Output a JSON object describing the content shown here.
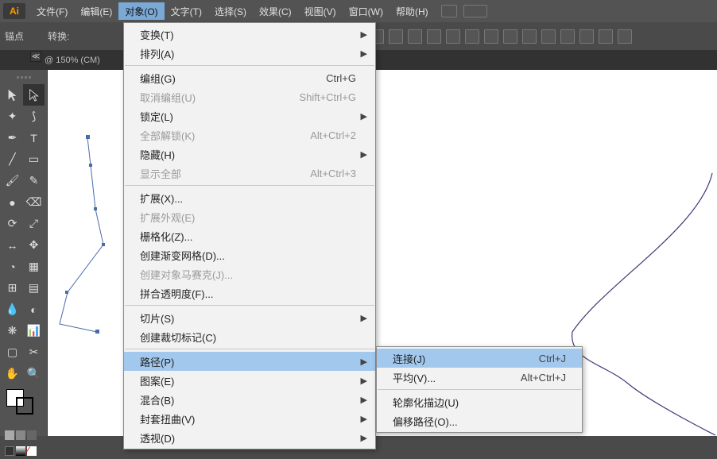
{
  "app": {
    "logo": "Ai"
  },
  "menubar": {
    "file": "文件(F)",
    "edit": "编辑(E)",
    "object": "对象(O)",
    "type": "文字(T)",
    "select": "选择(S)",
    "effect": "效果(C)",
    "view": "视图(V)",
    "window": "窗口(W)",
    "help": "帮助(H)"
  },
  "optionsbar": {
    "anchor": "锚点",
    "convert": "转换:"
  },
  "doctab": {
    "label": "@ 150% (CM)",
    "close": "≪"
  },
  "dropdown": [
    {
      "label": "变换(T)",
      "arrow": true
    },
    {
      "label": "排列(A)",
      "arrow": true
    },
    {
      "sep": true
    },
    {
      "label": "编组(G)",
      "shortcut": "Ctrl+G"
    },
    {
      "label": "取消编组(U)",
      "shortcut": "Shift+Ctrl+G",
      "disabled": true
    },
    {
      "label": "锁定(L)",
      "arrow": true
    },
    {
      "label": "全部解锁(K)",
      "shortcut": "Alt+Ctrl+2",
      "disabled": true
    },
    {
      "label": "隐藏(H)",
      "arrow": true
    },
    {
      "label": "显示全部",
      "shortcut": "Alt+Ctrl+3",
      "disabled": true
    },
    {
      "sep": true
    },
    {
      "label": "扩展(X)..."
    },
    {
      "label": "扩展外观(E)",
      "disabled": true
    },
    {
      "label": "栅格化(Z)..."
    },
    {
      "label": "创建渐变网格(D)..."
    },
    {
      "label": "创建对象马赛克(J)...",
      "disabled": true
    },
    {
      "label": "拼合透明度(F)..."
    },
    {
      "sep": true
    },
    {
      "label": "切片(S)",
      "arrow": true
    },
    {
      "label": "创建裁切标记(C)"
    },
    {
      "sep": true
    },
    {
      "label": "路径(P)",
      "arrow": true,
      "hover": true
    },
    {
      "label": "图案(E)",
      "arrow": true
    },
    {
      "label": "混合(B)",
      "arrow": true
    },
    {
      "label": "封套扭曲(V)",
      "arrow": true
    },
    {
      "label": "透视(D)",
      "arrow": true
    }
  ],
  "submenu": [
    {
      "label": "连接(J)",
      "shortcut": "Ctrl+J",
      "hover": true
    },
    {
      "label": "平均(V)...",
      "shortcut": "Alt+Ctrl+J"
    },
    {
      "sep": true
    },
    {
      "label": "轮廓化描边(U)"
    },
    {
      "label": "偏移路径(O)..."
    }
  ],
  "tool_tips": {
    "sel": "选择",
    "dsel": "直接选择",
    "wand": "魔棒",
    "lasso": "套索",
    "pen": "钢笔",
    "type": "文字",
    "line": "直线段",
    "rect": "矩形",
    "brush": "画笔",
    "pencil": "铅笔",
    "blob": "斑点画笔",
    "eraser": "橡皮擦",
    "rotate": "旋转",
    "scale": "比例缩放",
    "width": "宽度",
    "free": "自由变换",
    "shape": "形状生成器",
    "persp": "透视网格",
    "mesh": "网格",
    "grad": "渐变",
    "eyedrop": "吸管",
    "blend": "混合",
    "symbol": "符号喷枪",
    "graph": "柱形图",
    "artboard": "画板",
    "slice": "切片",
    "hand": "抓手",
    "zoom": "缩放"
  }
}
